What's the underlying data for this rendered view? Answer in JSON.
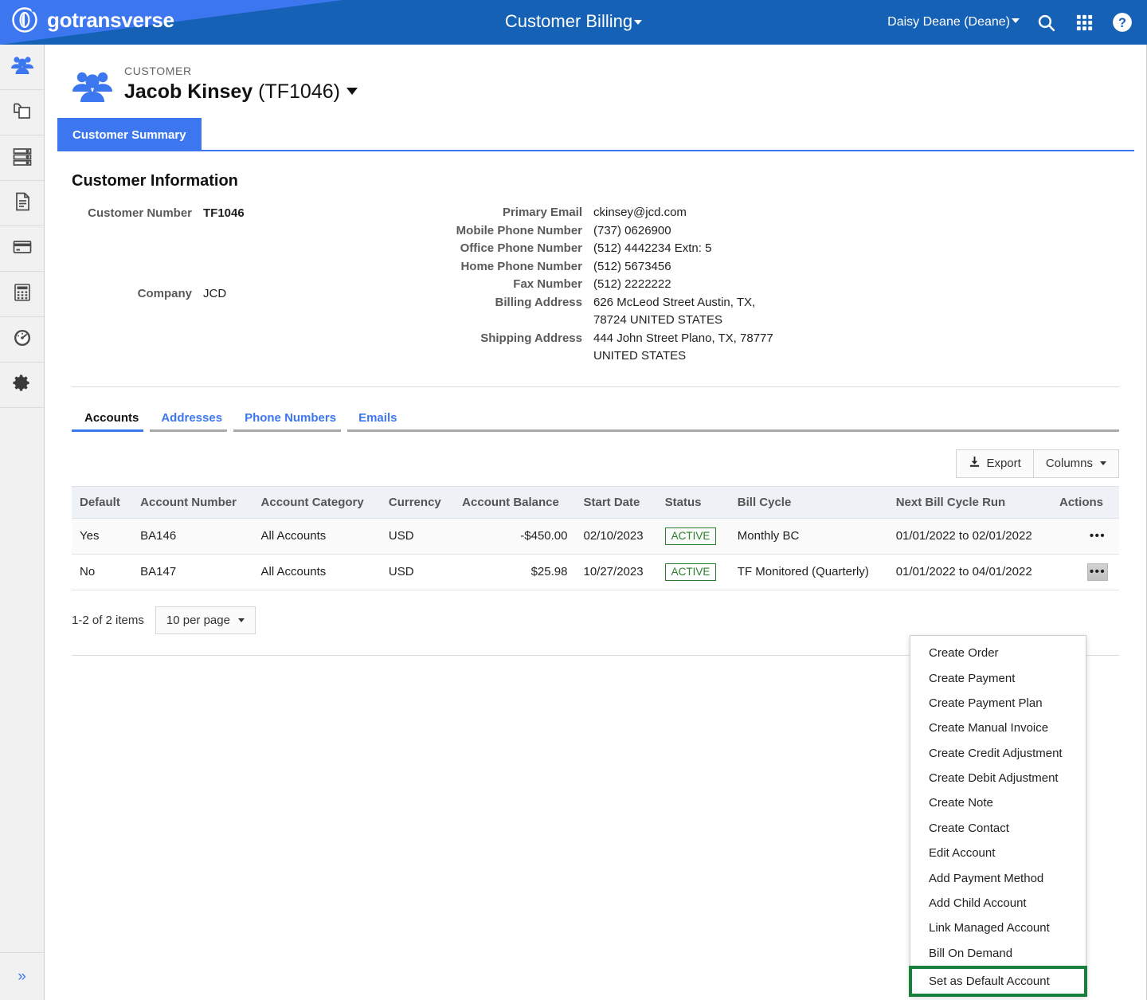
{
  "topbar": {
    "brand": "gotransverse",
    "brand_logo_icon": "gotransverse-logo-icon",
    "app_title": "Customer Billing",
    "user_menu": "Daisy Deane (Deane)",
    "search_icon": "search-icon",
    "apps_icon": "apps-grid-icon",
    "help_icon": "help-icon",
    "accent": "#3d77f0",
    "bg": "#1561b5"
  },
  "sidebar": {
    "items": [
      {
        "icon": "customers-icon",
        "active": true
      },
      {
        "icon": "products-copy-icon",
        "active": false
      },
      {
        "icon": "server-list-icon",
        "active": false
      },
      {
        "icon": "document-icon",
        "active": false
      },
      {
        "icon": "credit-card-icon",
        "active": false
      },
      {
        "icon": "calculator-icon",
        "active": false
      },
      {
        "icon": "dashboard-gauge-icon",
        "active": false
      },
      {
        "icon": "gear-icon",
        "active": false
      }
    ],
    "expand_label": "»",
    "expand_icon": "chevron-double-right-icon"
  },
  "customer_header": {
    "eyebrow": "CUSTOMER",
    "name": "Jacob Kinsey",
    "number_paren": "(TF1046)",
    "avatar_icon": "customer-group-icon",
    "dropdown_icon": "chevron-down-icon",
    "tab": "Customer Summary"
  },
  "customer_information": {
    "title": "Customer Information",
    "left": [
      {
        "label": "Customer Number",
        "value": "TF1046",
        "bold": true
      },
      {
        "label": "Company",
        "value": "JCD",
        "bold": false
      }
    ],
    "right": [
      {
        "label": "Primary Email",
        "value": "ckinsey@jcd.com"
      },
      {
        "label": "Mobile Phone Number",
        "value": "(737) 0626900"
      },
      {
        "label": "Office Phone Number",
        "value": "(512) 4442234 Extn: 5"
      },
      {
        "label": "Home Phone Number",
        "value": "(512) 5673456"
      },
      {
        "label": "Fax Number",
        "value": "(512) 2222222"
      },
      {
        "label": "Billing Address",
        "value": "626 McLeod Street Austin, TX, 78724 UNITED STATES"
      },
      {
        "label": "Shipping Address",
        "value": "444 John Street Plano, TX, 78777 UNITED STATES"
      }
    ]
  },
  "subtabs": [
    {
      "label": "Accounts",
      "active": true
    },
    {
      "label": "Addresses",
      "active": false
    },
    {
      "label": "Phone Numbers",
      "active": false
    },
    {
      "label": "Emails",
      "active": false
    }
  ],
  "toolbar": {
    "export_label": "Export",
    "export_icon": "download-icon",
    "columns_label": "Columns",
    "columns_icon": "chevron-down-icon"
  },
  "accounts_table": {
    "columns": [
      "Default",
      "Account Number",
      "Account Category",
      "Currency",
      "Account Balance",
      "Start Date",
      "Status",
      "Bill Cycle",
      "Next Bill Cycle Run",
      "Actions"
    ],
    "rows": [
      {
        "default": "Yes",
        "account_number": "BA146",
        "account_category": "All Accounts",
        "currency": "USD",
        "account_balance": "-$450.00",
        "start_date": "02/10/2023",
        "status": "ACTIVE",
        "bill_cycle": "Monthly BC",
        "next_bill_cycle_run": "01/01/2022 to 02/01/2022",
        "actions_icon": "ellipsis-icon"
      },
      {
        "default": "No",
        "account_number": "BA147",
        "account_category": "All Accounts",
        "currency": "USD",
        "account_balance": "$25.98",
        "start_date": "10/27/2023",
        "status": "ACTIVE",
        "bill_cycle": "TF Monitored (Quarterly)",
        "next_bill_cycle_run": "01/01/2022 to 04/01/2022",
        "actions_icon": "ellipsis-icon"
      }
    ]
  },
  "pagination": {
    "summary": "1-2 of 2 items",
    "per_page": "10 per page",
    "per_page_icon": "chevron-down-icon"
  },
  "context_menu": {
    "highlight_color": "#18803c",
    "items": [
      {
        "label": "Create Order",
        "highlighted": false
      },
      {
        "label": "Create Payment",
        "highlighted": false
      },
      {
        "label": "Create Payment Plan",
        "highlighted": false
      },
      {
        "label": "Create Manual Invoice",
        "highlighted": false
      },
      {
        "label": "Create Credit Adjustment",
        "highlighted": false
      },
      {
        "label": "Create Debit Adjustment",
        "highlighted": false
      },
      {
        "label": "Create Note",
        "highlighted": false
      },
      {
        "label": "Create Contact",
        "highlighted": false
      },
      {
        "label": "Edit Account",
        "highlighted": false
      },
      {
        "label": "Add Payment Method",
        "highlighted": false
      },
      {
        "label": "Add Child Account",
        "highlighted": false
      },
      {
        "label": "Link Managed Account",
        "highlighted": false
      },
      {
        "label": "Bill On Demand",
        "highlighted": false
      },
      {
        "label": "Set as Default Account",
        "highlighted": true
      }
    ]
  }
}
